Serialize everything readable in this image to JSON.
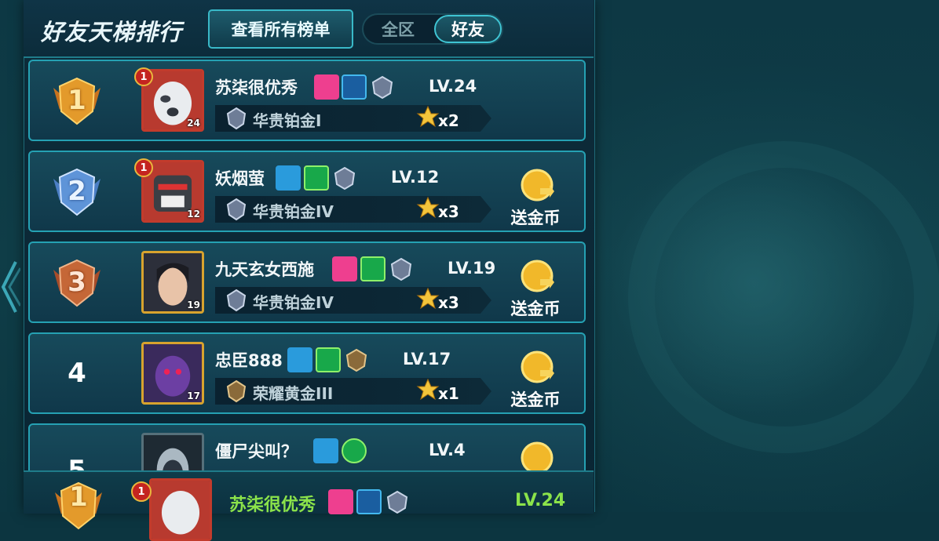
{
  "header": {
    "title": "好友天梯排行",
    "view_all": "查看所有榜单",
    "tabs": [
      {
        "label": "全区",
        "active": false
      },
      {
        "label": "好友",
        "active": true
      }
    ]
  },
  "rows": [
    {
      "rank": "1",
      "name": "苏柒很优秀",
      "gender": "female",
      "level": "LV.24",
      "avatar_level": "24",
      "badge": "1",
      "tier": "华贵铂金I",
      "stars": "x2",
      "gift": ""
    },
    {
      "rank": "2",
      "name": "妖烟萤",
      "gender": "male",
      "level": "LV.12",
      "avatar_level": "12",
      "badge": "1",
      "tier": "华贵铂金IV",
      "stars": "x3",
      "gift": "送金币"
    },
    {
      "rank": "3",
      "name": "九天玄女西施",
      "gender": "female",
      "level": "LV.19",
      "avatar_level": "19",
      "badge": "",
      "tier": "华贵铂金IV",
      "stars": "x3",
      "gift": "送金币"
    },
    {
      "rank": "4",
      "name": "忠臣888",
      "gender": "male",
      "level": "LV.17",
      "avatar_level": "17",
      "badge": "",
      "tier": "荣耀黄金III",
      "stars": "x1",
      "gift": "送金币"
    },
    {
      "rank": "5",
      "name": "僵尸尖叫？",
      "gender": "male",
      "level": "LV.4",
      "avatar_level": "",
      "badge": "",
      "tier": "",
      "stars": "",
      "gift": ""
    }
  ],
  "self": {
    "rank": "1",
    "badge": "1",
    "name": "苏柒很优秀",
    "level": "LV.24"
  },
  "colors": {
    "accent": "#25a1b3",
    "self_text": "#8be34a",
    "female": "#ee3f8f",
    "male": "#2a9bdc"
  },
  "icons": [
    "female-icon",
    "male-icon",
    "vip-icon",
    "tier-icon",
    "star-icon",
    "gold-coin-icon",
    "rank-medal-icon",
    "back-arrow-icon"
  ]
}
